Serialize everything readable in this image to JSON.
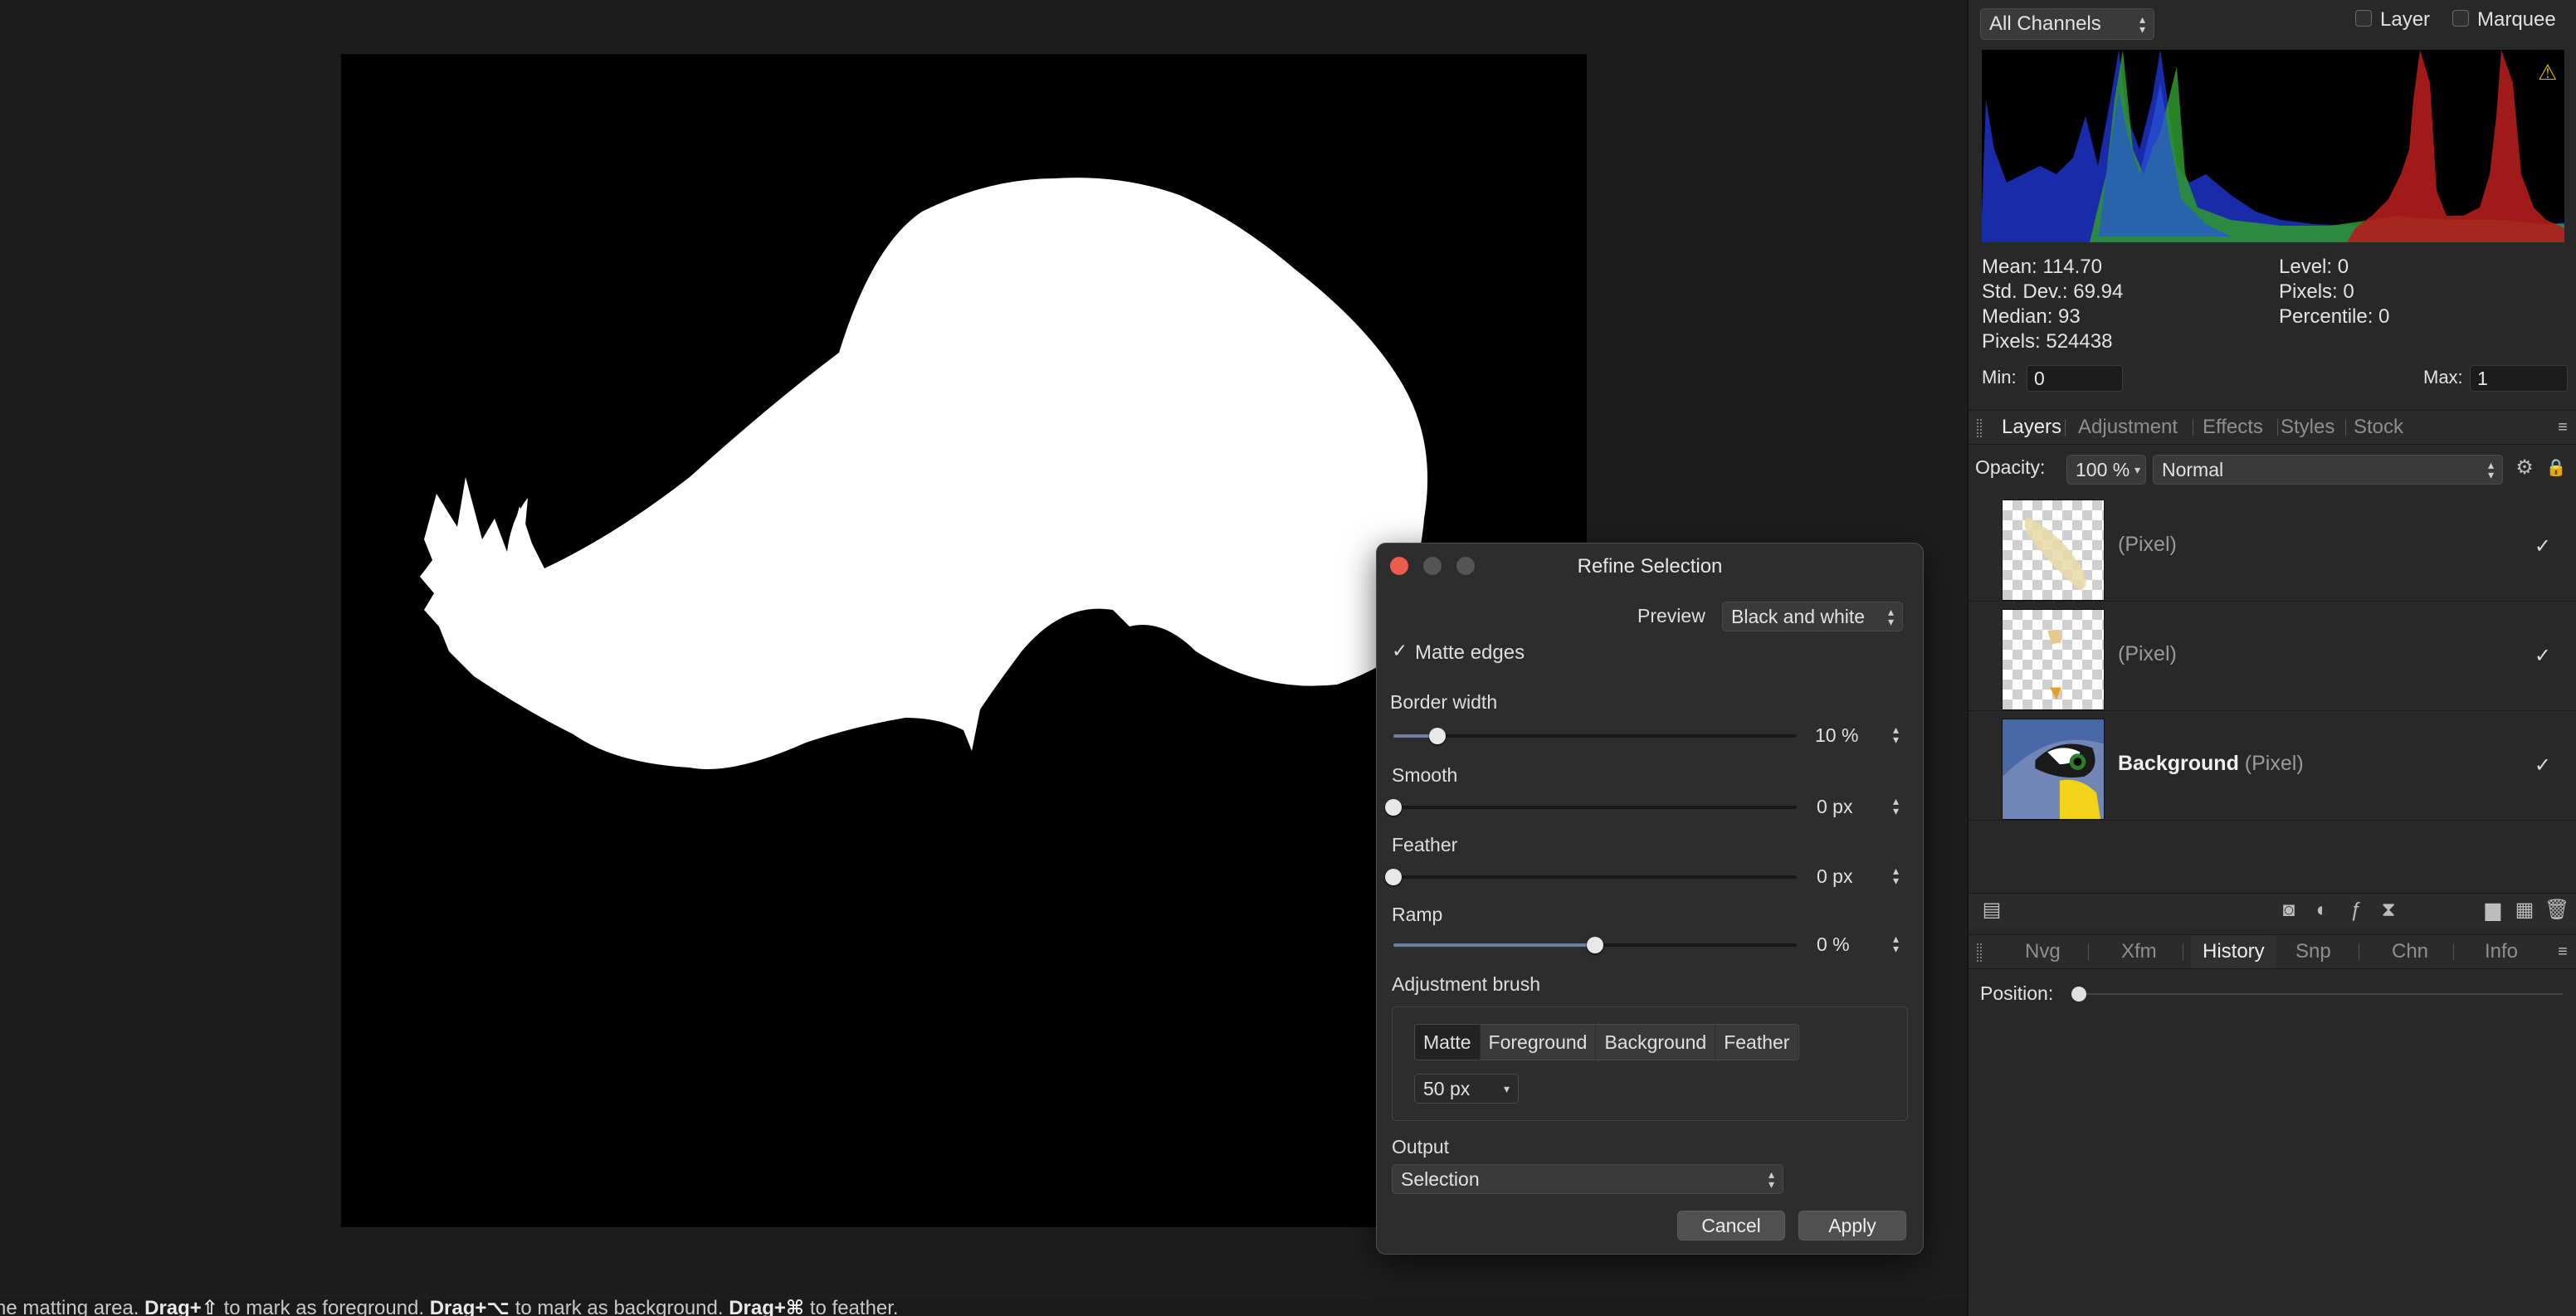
{
  "statusbar": {
    "text_part1": "he matting area. ",
    "key1": "Drag+⇧",
    "text_part2": " to mark as foreground. ",
    "key2": "Drag+⌥",
    "text_part3": " to mark as background. ",
    "key3": "Drag+⌘",
    "text_part4": " to feather."
  },
  "histogram": {
    "channel_select": "All Channels",
    "layer_label": "Layer",
    "marquee_label": "Marquee",
    "mean": "Mean: 114.70",
    "std_dev": "Std. Dev.: 69.94",
    "median": "Median: 93",
    "pixels": "Pixels: 524438",
    "level": "Level: 0",
    "pixels_sel": "Pixels: 0",
    "percentile": "Percentile: 0",
    "min_label": "Min:",
    "min_value": "0",
    "max_label": "Max:",
    "max_value": "1",
    "warning_icon": "warning-icon"
  },
  "layers_panel": {
    "tabs": [
      "Layers",
      "Adjustment",
      "Effects",
      "Styles",
      "Stock"
    ],
    "opacity_label": "Opacity:",
    "opacity_value": "100 %",
    "blend_mode": "Normal",
    "layers": [
      {
        "name": "",
        "type": "(Pixel)",
        "visible": "✓"
      },
      {
        "name": "",
        "type": "(Pixel)",
        "visible": "✓"
      },
      {
        "name": "Background",
        "type": " (Pixel)",
        "visible": "✓"
      }
    ]
  },
  "bottom_tabs": {
    "tabs": [
      "Nvg",
      "Xfm",
      "History",
      "Snp",
      "Chn",
      "Info"
    ],
    "position_label": "Position:"
  },
  "dialog": {
    "title": "Refine Selection",
    "preview_label": "Preview",
    "preview_value": "Black and white",
    "matte_edges_check": "✓",
    "matte_edges_label": "Matte edges",
    "border_width_label": "Border width",
    "border_width_value": "10 %",
    "border_width_fraction": 0.11,
    "smooth_label": "Smooth",
    "smooth_value": "0 px",
    "smooth_fraction": 0,
    "feather_label": "Feather",
    "feather_value": "0 px",
    "feather_fraction": 0,
    "ramp_label": "Ramp",
    "ramp_value": "0 %",
    "ramp_fraction": 0.5,
    "adjustment_brush_label": "Adjustment brush",
    "brush_modes": [
      "Matte",
      "Foreground",
      "Background",
      "Feather"
    ],
    "brush_size": "50 px",
    "output_label": "Output",
    "output_value": "Selection",
    "cancel_label": "Cancel",
    "apply_label": "Apply"
  },
  "colors": {
    "accent": "#6f7fa3",
    "close_red": "#ee5c50"
  }
}
